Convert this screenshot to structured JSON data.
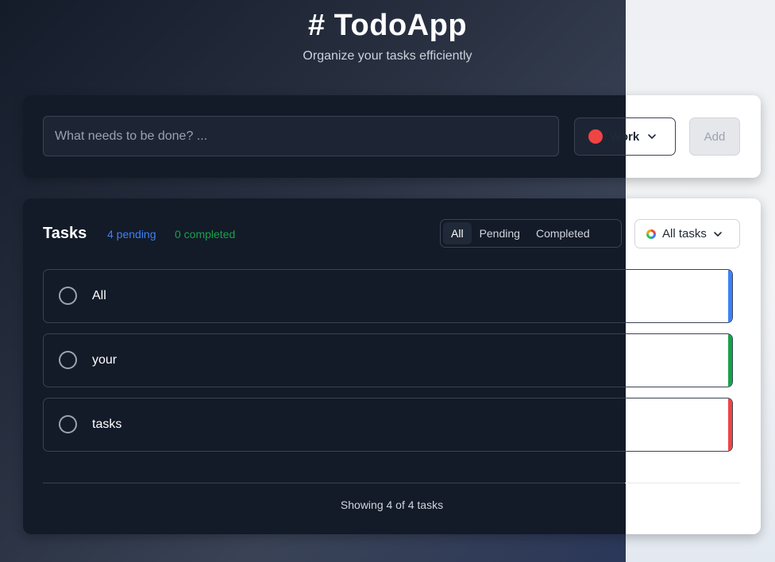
{
  "header": {
    "title": "# TodoApp",
    "subtitle": "Organize your tasks efficiently"
  },
  "add_form": {
    "input_placeholder": "What needs to be done? ...",
    "input_value": "",
    "category": {
      "label": "Work",
      "color": "#ef4444",
      "icon": "chevron-down-icon"
    },
    "add_label": "Add"
  },
  "tasks_panel": {
    "title": "Tasks",
    "pending": "4 pending",
    "completed": "0 completed",
    "filters": [
      {
        "label": "All",
        "active": true
      },
      {
        "label": "Pending",
        "active": false
      },
      {
        "label": "Completed",
        "active": false
      }
    ],
    "category_filter": {
      "label": "All tasks",
      "icon": "multicolor-ring-icon"
    },
    "items": [
      {
        "text": "All",
        "accent": "#3b82f6",
        "done": false
      },
      {
        "text": "your",
        "accent": "#16a34a",
        "done": false
      },
      {
        "text": "tasks",
        "accent": "#ef4444",
        "done": false
      }
    ],
    "footer": "Showing 4 of 4 tasks"
  },
  "colors": {
    "pending": "#3b82f6",
    "completed": "#16a34a",
    "card_dark": "#131a28"
  }
}
